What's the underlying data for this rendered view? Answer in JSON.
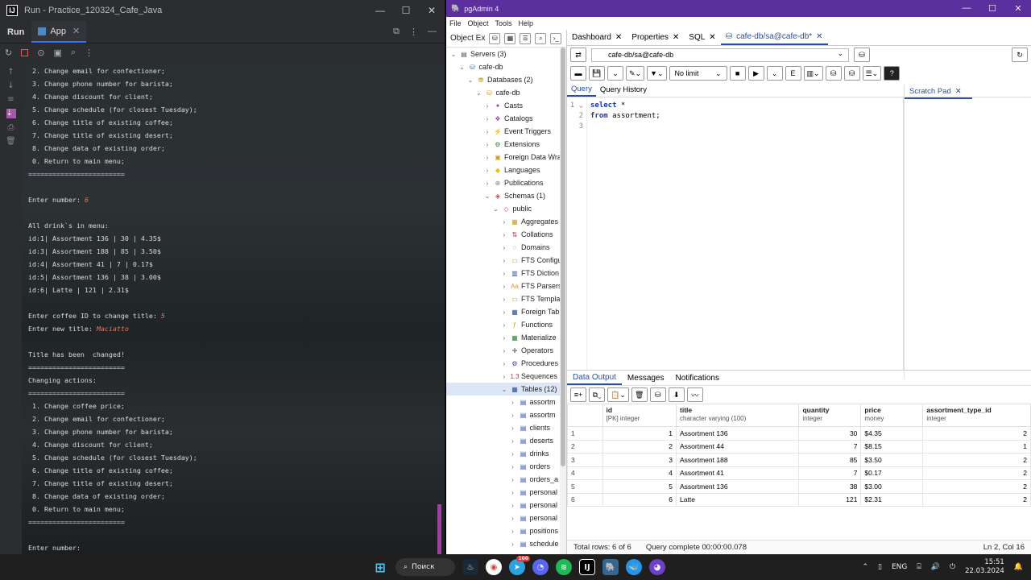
{
  "ide": {
    "title": "Run - Practice_120324_Cafe_Java",
    "run_label": "Run",
    "tab_label": "App",
    "console_lines": [
      " 2. Change email for confectioner;",
      " 3. Change phone number for barista;",
      " 4. Change discount for client;",
      " 5. Change schedule (for closest Tuesday);",
      " 6. Change title of existing coffee;",
      " 7. Change title of existing desert;",
      " 8. Change data of existing order;",
      " 0. Return to main menu;",
      "========================",
      "",
      "Enter number: |6",
      "",
      "All drink`s in menu:",
      "id:1| Assortment 136 | 30 | 4.35$",
      "id:3| Assortment 188 | 85 | 3.50$",
      "id:4| Assortment 41 | 7 | 0.17$",
      "id:5| Assortment 136 | 38 | 3.00$",
      "id:6| Latte | 121 | 2.31$",
      "",
      "Enter coffee ID to change title: |5",
      "Enter new title: |Maciatto",
      "",
      "Title has been  changed!",
      "========================",
      "Changing actions:",
      "========================",
      " 1. Change coffee price;",
      " 2. Change email for confectioner;",
      " 3. Change phone number for barista;",
      " 4. Change discount for client;",
      " 5. Change schedule (for closest Tuesday);",
      " 6. Change title of existing coffee;",
      " 7. Change title of existing desert;",
      " 8. Change data of existing order;",
      " 0. Return to main menu;",
      "========================",
      "",
      "Enter number:"
    ]
  },
  "pg": {
    "title": "pgAdmin 4",
    "menu": [
      "File",
      "Object",
      "Tools",
      "Help"
    ],
    "explorer_label": "Object Ex",
    "tree": [
      {
        "d": 0,
        "exp": "⌄",
        "icon": "▤",
        "label": "Servers (3)",
        "c": "#555"
      },
      {
        "d": 1,
        "exp": "⌄",
        "icon": "⛁",
        "label": "cafe-db",
        "c": "#2f6fb0"
      },
      {
        "d": 2,
        "exp": "⌄",
        "icon": "⛃",
        "label": "Databases (2)",
        "c": "#c9a227"
      },
      {
        "d": 3,
        "exp": "⌄",
        "icon": "⛁",
        "label": "cafe-db",
        "c": "#c9a227"
      },
      {
        "d": 4,
        "exp": "›",
        "icon": "✦",
        "label": "Casts",
        "c": "#a03ab0"
      },
      {
        "d": 4,
        "exp": "›",
        "icon": "❖",
        "label": "Catalogs",
        "c": "#a03ab0"
      },
      {
        "d": 4,
        "exp": "›",
        "icon": "⚡",
        "label": "Event Triggers",
        "c": "#c9a227"
      },
      {
        "d": 4,
        "exp": "›",
        "icon": "⚙",
        "label": "Extensions",
        "c": "#2a8a3a"
      },
      {
        "d": 4,
        "exp": "›",
        "icon": "▣",
        "label": "Foreign Data Wra",
        "c": "#c9a227"
      },
      {
        "d": 4,
        "exp": "›",
        "icon": "◆",
        "label": "Languages",
        "c": "#e6c300"
      },
      {
        "d": 4,
        "exp": "›",
        "icon": "⊕",
        "label": "Publications",
        "c": "#888"
      },
      {
        "d": 4,
        "exp": "⌄",
        "icon": "◈",
        "label": "Schemas (1)",
        "c": "#d04040"
      },
      {
        "d": 5,
        "exp": "⌄",
        "icon": "◇",
        "label": "public",
        "c": "#d04040"
      },
      {
        "d": 6,
        "exp": "›",
        "icon": "▦",
        "label": "Aggregates",
        "c": "#c9a227"
      },
      {
        "d": 6,
        "exp": "›",
        "icon": "⇅",
        "label": "Collations",
        "c": "#c03030"
      },
      {
        "d": 6,
        "exp": "›",
        "icon": "◌",
        "label": "Domains",
        "c": "#2a4f9c"
      },
      {
        "d": 6,
        "exp": "›",
        "icon": "▭",
        "label": "FTS Configu",
        "c": "#c9a227"
      },
      {
        "d": 6,
        "exp": "›",
        "icon": "▥",
        "label": "FTS Diction",
        "c": "#2a4f9c"
      },
      {
        "d": 6,
        "exp": "›",
        "icon": "Aa",
        "label": "FTS Parsers",
        "c": "#c9a227"
      },
      {
        "d": 6,
        "exp": "›",
        "icon": "▭",
        "label": "FTS Templa",
        "c": "#c9a227"
      },
      {
        "d": 6,
        "exp": "›",
        "icon": "▦",
        "label": "Foreign Tab",
        "c": "#2a4f9c"
      },
      {
        "d": 6,
        "exp": "›",
        "icon": "ƒ",
        "label": "Functions",
        "c": "#c9a227"
      },
      {
        "d": 6,
        "exp": "›",
        "icon": "▦",
        "label": "Materialize",
        "c": "#2a8a3a"
      },
      {
        "d": 6,
        "exp": "›",
        "icon": "✚",
        "label": "Operators",
        "c": "#888"
      },
      {
        "d": 6,
        "exp": "›",
        "icon": "⚙",
        "label": "Procedures",
        "c": "#2a4f9c"
      },
      {
        "d": 6,
        "exp": "›",
        "icon": "1.3",
        "label": "Sequences",
        "c": "#c03030"
      },
      {
        "d": 6,
        "exp": "⌄",
        "icon": "▦",
        "label": "Tables (12)",
        "c": "#2a4f9c",
        "sel": true
      },
      {
        "d": 7,
        "exp": "›",
        "icon": "▤",
        "label": "assortm",
        "c": "#2a4f9c"
      },
      {
        "d": 7,
        "exp": "›",
        "icon": "▤",
        "label": "assortm",
        "c": "#2a4f9c"
      },
      {
        "d": 7,
        "exp": "›",
        "icon": "▤",
        "label": "clients",
        "c": "#2a4f9c"
      },
      {
        "d": 7,
        "exp": "›",
        "icon": "▤",
        "label": "deserts",
        "c": "#2a4f9c"
      },
      {
        "d": 7,
        "exp": "›",
        "icon": "▤",
        "label": "drinks",
        "c": "#2a4f9c"
      },
      {
        "d": 7,
        "exp": "›",
        "icon": "▤",
        "label": "orders",
        "c": "#2a4f9c"
      },
      {
        "d": 7,
        "exp": "›",
        "icon": "▤",
        "label": "orders_a",
        "c": "#2a4f9c"
      },
      {
        "d": 7,
        "exp": "›",
        "icon": "▤",
        "label": "personal",
        "c": "#2a4f9c"
      },
      {
        "d": 7,
        "exp": "›",
        "icon": "▤",
        "label": "personal",
        "c": "#2a4f9c"
      },
      {
        "d": 7,
        "exp": "›",
        "icon": "▤",
        "label": "personal",
        "c": "#2a4f9c"
      },
      {
        "d": 7,
        "exp": "›",
        "icon": "▤",
        "label": "positions",
        "c": "#2a4f9c"
      },
      {
        "d": 7,
        "exp": "›",
        "icon": "▤",
        "label": "schedule",
        "c": "#2a4f9c"
      }
    ],
    "tabs": {
      "dashboard": "Dashboard",
      "properties": "Properties",
      "sql": "SQL",
      "query": "cafe-db/sa@cafe-db*"
    },
    "connection": "cafe-db/sa@cafe-db",
    "no_limit": "No limit",
    "query_tabs": {
      "query": "Query",
      "history": "Query History"
    },
    "scratch_pad": "Scratch Pad",
    "code": [
      "select *",
      "from assortment;",
      ""
    ],
    "output_tabs": {
      "data": "Data Output",
      "messages": "Messages",
      "notifications": "Notifications"
    },
    "columns": [
      {
        "name": "id",
        "type": "[PK] integer"
      },
      {
        "name": "title",
        "type": "character varying (100)"
      },
      {
        "name": "quantity",
        "type": "integer"
      },
      {
        "name": "price",
        "type": "money"
      },
      {
        "name": "assortment_type_id",
        "type": "integer"
      }
    ],
    "rows": [
      [
        "1",
        "1",
        "Assortment 136",
        "30",
        "$4.35",
        "2"
      ],
      [
        "2",
        "2",
        "Assortment 44",
        "7",
        "$8.15",
        "1"
      ],
      [
        "3",
        "3",
        "Assortment 188",
        "85",
        "$3.50",
        "2"
      ],
      [
        "4",
        "4",
        "Assortment 41",
        "7",
        "$0.17",
        "2"
      ],
      [
        "5",
        "5",
        "Assortment 136",
        "38",
        "$3.00",
        "2"
      ],
      [
        "6",
        "6",
        "Latte",
        "121",
        "$2.31",
        "2"
      ]
    ],
    "status": {
      "rows": "Total rows: 6 of 6",
      "time": "Query complete 00:00:00.078",
      "pos": "Ln 2, Col 16"
    }
  },
  "taskbar": {
    "search": "Поиск",
    "lang": "ENG",
    "time": "15:51",
    "date": "22.03.2024",
    "badge": "100"
  }
}
